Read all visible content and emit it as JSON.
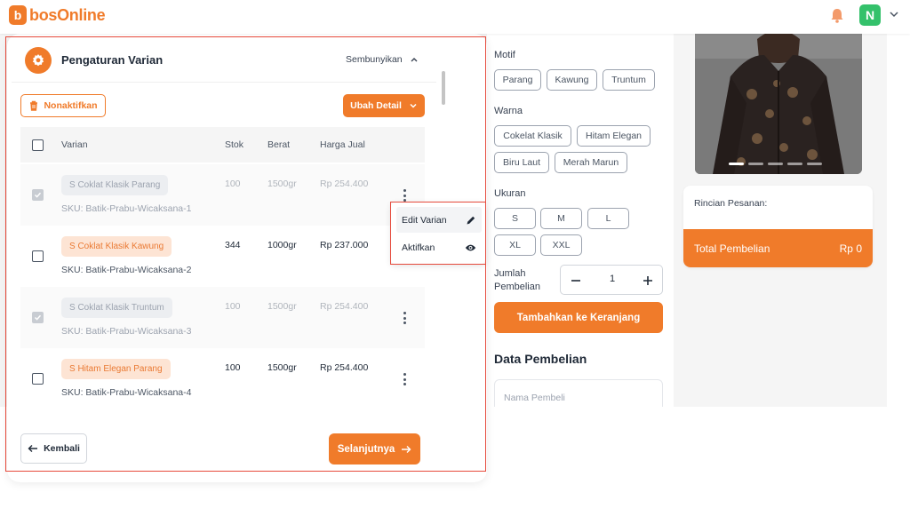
{
  "header": {
    "logo_mark": "b",
    "logo_text": "bosOnline",
    "avatar_initial": "N",
    "colors": {
      "brand": "#f07b2a",
      "avatar": "#34c16b",
      "highlight": "#e64a3c"
    }
  },
  "panel": {
    "title": "Pengaturan Varian",
    "hide_label": "Sembunyikan",
    "deactivate_label": "Nonaktifkan",
    "edit_detail_label": "Ubah Detail",
    "columns": [
      "Varian",
      "Stok",
      "Berat",
      "Harga Jual"
    ],
    "rows": [
      {
        "name": "S Coklat Klasik Parang",
        "sku": "SKU: Batik-Prabu-Wicaksana-1",
        "stock": "100",
        "weight": "1500gr",
        "price": "Rp 254.400",
        "checked": true,
        "disabled": true
      },
      {
        "name": "S Coklat Klasik Kawung",
        "sku": "SKU: Batik-Prabu-Wicaksana-2",
        "stock": "344",
        "weight": "1000gr",
        "price": "Rp 237.000",
        "checked": false,
        "disabled": false
      },
      {
        "name": "S Coklat Klasik Truntum",
        "sku": "SKU: Batik-Prabu-Wicaksana-3",
        "stock": "100",
        "weight": "1500gr",
        "price": "Rp 254.400",
        "checked": true,
        "disabled": true
      },
      {
        "name": "S Hitam Elegan Parang",
        "sku": "SKU: Batik-Prabu-Wicaksana-4",
        "stock": "100",
        "weight": "1500gr",
        "price": "Rp 254.400",
        "checked": false,
        "disabled": false
      }
    ]
  },
  "context_menu": {
    "items": [
      {
        "label": "Edit Varian",
        "icon": "pencil-icon"
      },
      {
        "label": "Aktifkan",
        "icon": "eye-icon"
      }
    ]
  },
  "footer": {
    "back_label": "Kembali",
    "next_label": "Selanjutnya"
  },
  "options": {
    "motif_label": "Motif",
    "motif": [
      "Parang",
      "Kawung",
      "Truntum"
    ],
    "warna_label": "Warna",
    "warna": [
      "Cokelat Klasik",
      "Hitam Elegan",
      "Biru Laut",
      "Merah Marun"
    ],
    "ukuran_label": "Ukuran",
    "ukuran": [
      "S",
      "M",
      "L",
      "XL",
      "XXL"
    ],
    "qty_label_1": "Jumlah",
    "qty_label_2": "Pembelian",
    "qty_value": "1",
    "add_to_cart_label": "Tambahkan ke Keranjang",
    "buyer_section_title": "Data Pembelian",
    "buyer_name_placeholder": "Nama Pembeli"
  },
  "summary": {
    "title": "Rincian Pesanan:",
    "total_label": "Total Pembelian",
    "total_value": "Rp 0",
    "slides_total": 5,
    "slide_active": 1
  }
}
